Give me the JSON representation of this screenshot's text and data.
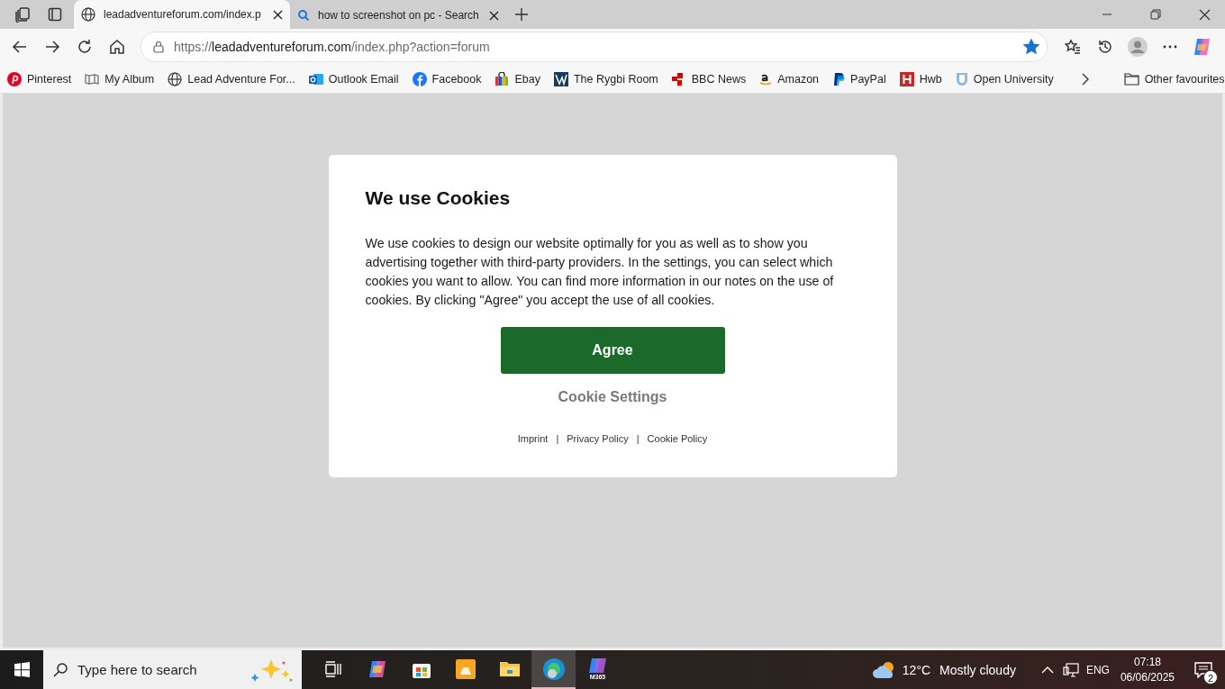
{
  "tabs": [
    {
      "label": "leadadventureforum.com/index.p",
      "kind": "site",
      "selected": true
    },
    {
      "label": "how to screenshot on pc - Search",
      "kind": "search",
      "selected": false
    }
  ],
  "address": {
    "url": "https://**leadadventureforum.com**/index.php?action=forum",
    "favourited": true
  },
  "bookmarks": [
    {
      "label": "Pinterest",
      "kind": "pinterest"
    },
    {
      "label": "My Album",
      "kind": "album"
    },
    {
      "label": "Lead Adventure For...",
      "kind": "globe"
    },
    {
      "label": "Outlook Email",
      "kind": "outlook"
    },
    {
      "label": "Facebook",
      "kind": "facebook"
    },
    {
      "label": "Ebay",
      "kind": "ebay"
    },
    {
      "label": "The Rygbi Room",
      "kind": "rygbi"
    },
    {
      "label": "BBC News",
      "kind": "bbc"
    },
    {
      "label": "Amazon",
      "kind": "amazon"
    },
    {
      "label": "PayPal",
      "kind": "paypal"
    },
    {
      "label": "Hwb",
      "kind": "hwb"
    },
    {
      "label": "Open University",
      "kind": "ou"
    }
  ],
  "other_favourites": "Other favourites",
  "dialog": {
    "title": "We use Cookies",
    "body": "We use cookies to design our website optimally for you as well as to show you advertising together with third-party providers. In the settings, you can select which cookies you want to allow. You can find more information in our notes on the use of cookies. By clicking \"Agree\" you accept the use of all cookies.",
    "agree": "Agree",
    "settings": "Cookie Settings",
    "links": [
      "Imprint",
      "Privacy Policy",
      "Cookie Policy"
    ],
    "separator": "|"
  },
  "taskbar": {
    "search_placeholder": "Type here to search",
    "apps": [
      {
        "kind": "taskview",
        "selected": false
      },
      {
        "kind": "copilot",
        "selected": false
      },
      {
        "kind": "store",
        "selected": false
      },
      {
        "kind": "photos",
        "selected": false
      },
      {
        "kind": "explorer",
        "selected": false
      },
      {
        "kind": "edge",
        "selected": true
      },
      {
        "kind": "m365",
        "label": "M365",
        "selected": false
      }
    ],
    "temperature": "12°C",
    "weather": "Mostly cloudy",
    "language": "ENG",
    "time": "07:18",
    "date": "06/06/2025",
    "notifications": "2"
  }
}
